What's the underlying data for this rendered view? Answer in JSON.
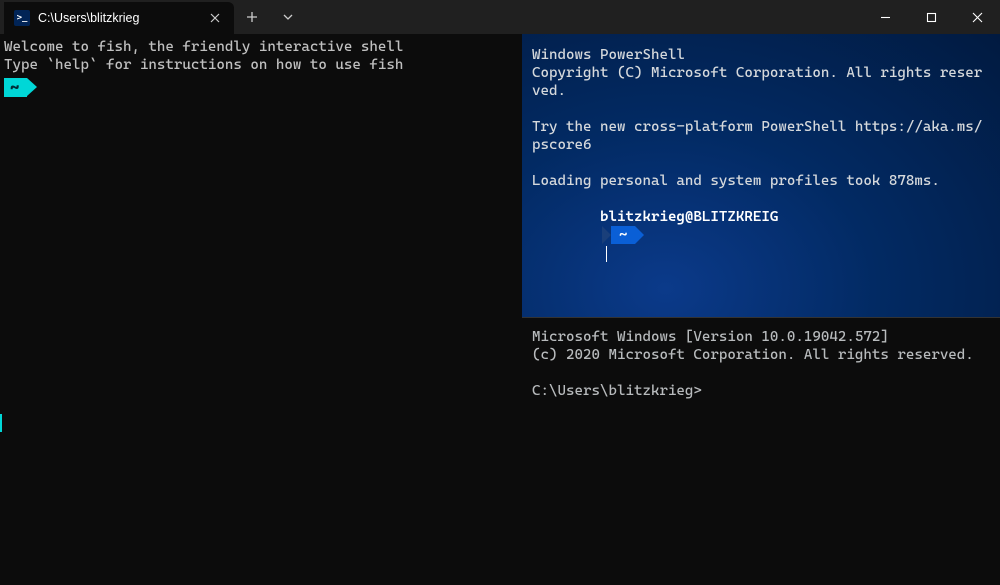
{
  "window": {
    "tab_icon_text": ">_",
    "tab_title": "C:\\Users\\blitzkrieg"
  },
  "fish": {
    "line1": "Welcome to fish, the friendly interactive shell",
    "line2": "Type `help` for instructions on how to use fish",
    "prompt_dir": "~"
  },
  "powershell": {
    "line1": "Windows PowerShell",
    "line2": "Copyright (C) Microsoft Corporation. All rights reserved.",
    "line3": "Try the new cross-platform PowerShell https://aka.ms/pscore6",
    "line4": "Loading personal and system profiles took 878ms.",
    "prompt_user": "blitzkrieg@BLITZKREIG",
    "prompt_dir": "~"
  },
  "cmd": {
    "line1": "Microsoft Windows [Version 10.0.19042.572]",
    "line2": "(c) 2020 Microsoft Corporation. All rights reserved.",
    "prompt": "C:\\Users\\blitzkrieg>"
  }
}
